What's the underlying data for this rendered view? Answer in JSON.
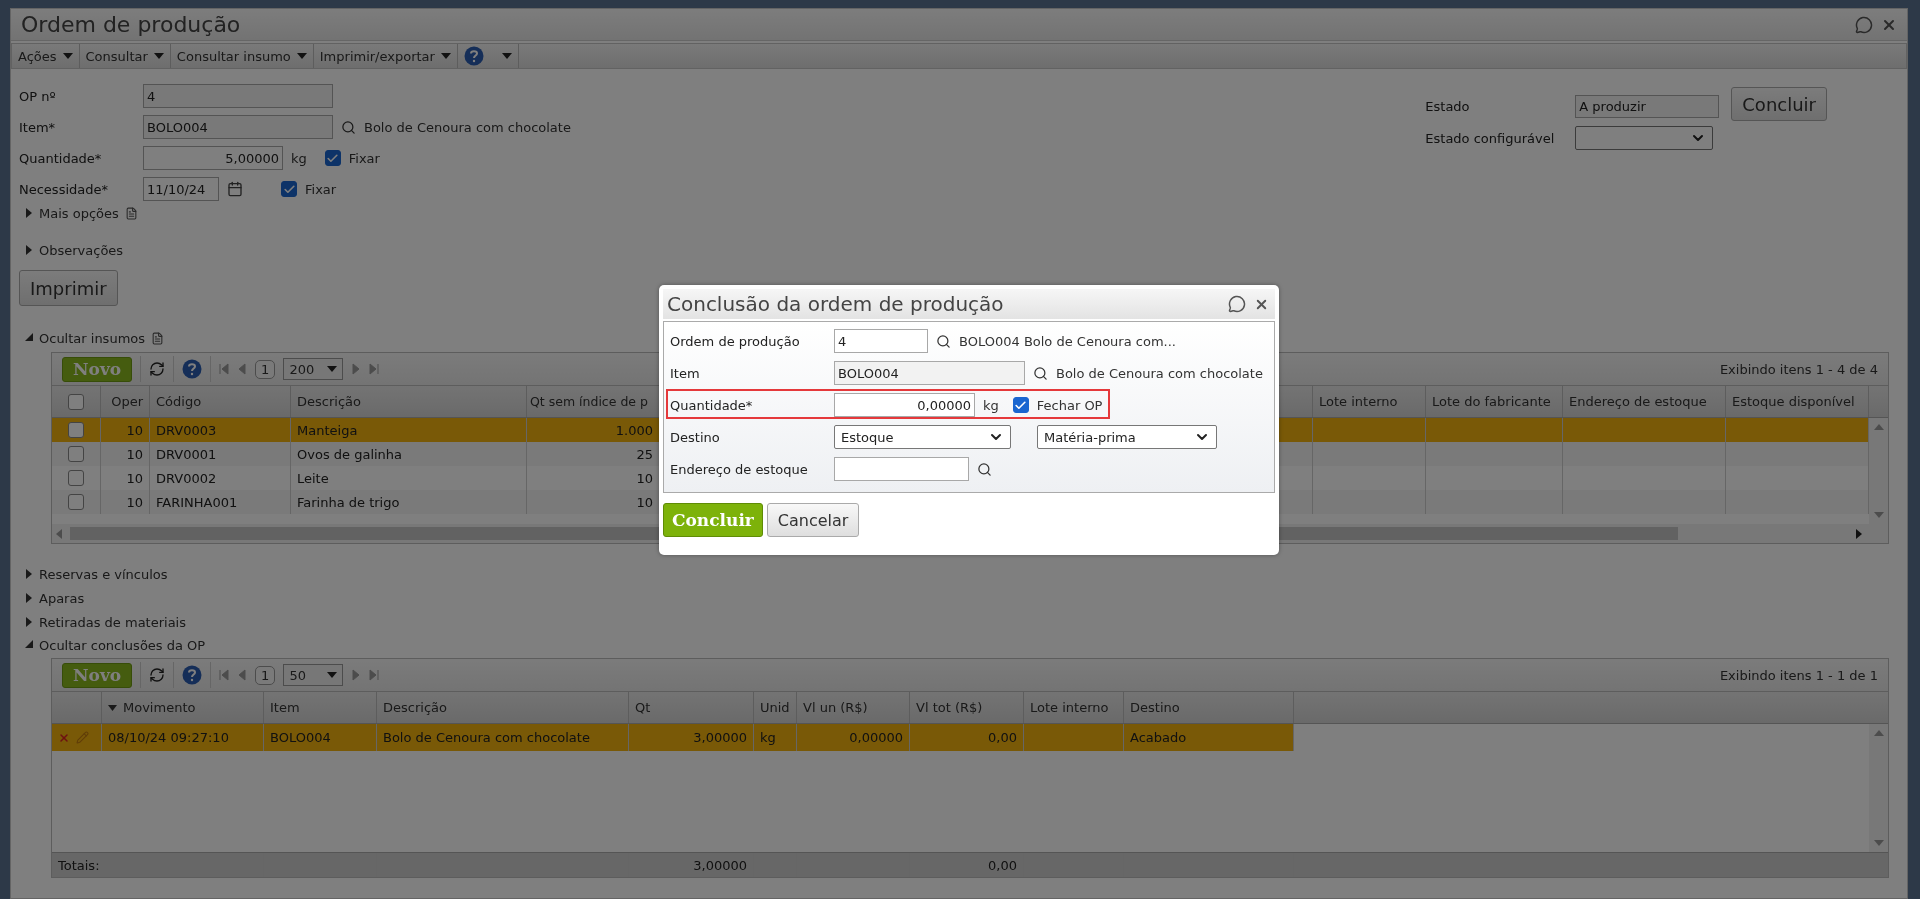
{
  "window": {
    "title": "Ordem de produção"
  },
  "menu": [
    {
      "label": "Ações"
    },
    {
      "label": "Consultar"
    },
    {
      "label": "Consultar insumo"
    },
    {
      "label": "Imprimir/exportar"
    }
  ],
  "form": {
    "fields": [
      {
        "kind": "text",
        "label": "OP nº",
        "value": "4"
      },
      {
        "kind": "lookup",
        "label": "Item*",
        "value": "BOLO004",
        "description": "Bolo de Cenoura com chocolate"
      },
      {
        "kind": "quantity",
        "label": "Quantidade*",
        "value": "5,00000",
        "unit": "kg",
        "fix": {
          "label": "Fixar",
          "checked": true
        }
      },
      {
        "kind": "date",
        "label": "Necessidade*",
        "value": "11/10/24",
        "fix": {
          "label": "Fixar",
          "checked": true
        }
      }
    ],
    "state": {
      "label": "Estado",
      "value": "A produzir"
    },
    "configurable_state": {
      "label": "Estado configurável"
    },
    "conclude_button": "Concluir"
  },
  "panels": [
    {
      "label": "Mais opções",
      "expanded": false,
      "notes": true
    },
    {
      "label": "Observações",
      "expanded": false,
      "notes": false
    }
  ],
  "print_button": "Imprimir",
  "inputs_section": {
    "label": "Ocultar insumos",
    "expanded": true,
    "grid": {
      "all_checked": false,
      "new_button": "Novo",
      "page": "1",
      "page_size": "200",
      "status": "Exibindo itens 1 - 4 de 4",
      "columns": [
        "Oper",
        "Código",
        "Descrição",
        "Qt sem índice de p",
        "Lote interno",
        "Lote do fabricante",
        "Endereço de estoque",
        "Estoque disponível"
      ],
      "rows": [
        {
          "selected": true,
          "checked": false,
          "cells": [
            "10",
            "DRV0003",
            "Manteiga",
            "1.000"
          ]
        },
        {
          "selected": false,
          "checked": false,
          "cells": [
            "10",
            "DRV0001",
            "Ovos de galinha",
            "25"
          ]
        },
        {
          "selected": false,
          "checked": false,
          "cells": [
            "10",
            "DRV0002",
            "Leite",
            "10"
          ]
        },
        {
          "selected": false,
          "checked": false,
          "cells": [
            "10",
            "FARINHA001",
            "Farinha de trigo",
            "10"
          ]
        }
      ]
    }
  },
  "lower_panels": [
    {
      "label": "Reservas e vínculos",
      "expanded": false
    },
    {
      "label": "Aparas",
      "expanded": false
    },
    {
      "label": "Retiradas de materiais",
      "expanded": false
    }
  ],
  "completions_section": {
    "label": "Ocultar conclusões da OP",
    "expanded": true,
    "grid": {
      "new_button": "Novo",
      "page": "1",
      "page_size": "50",
      "status": "Exibindo itens 1 - 1 de 1",
      "columns": [
        {
          "label": "Movimento",
          "sorted": true
        },
        {
          "label": "Item",
          "sorted": false
        },
        {
          "label": "Descrição",
          "sorted": false
        },
        {
          "label": "Qt",
          "sorted": false
        },
        {
          "label": "Unid",
          "sorted": false
        },
        {
          "label": "Vl un (R$)",
          "sorted": false
        },
        {
          "label": "Vl tot (R$)",
          "sorted": false
        },
        {
          "label": "Lote interno",
          "sorted": false
        },
        {
          "label": "Destino",
          "sorted": false
        }
      ],
      "rows": [
        {
          "selected": true,
          "cells": [
            "08/10/24 09:27:10",
            "BOLO004",
            "Bolo de Cenoura com chocolate",
            "3,00000",
            "kg",
            "0,00000",
            "0,00",
            "",
            "Acabado"
          ]
        }
      ],
      "totals": {
        "label": "Totais:",
        "qt": "3,00000",
        "total_value": "0,00"
      }
    }
  },
  "dialog": {
    "title": "Conclusão da ordem de produção",
    "order": {
      "label": "Ordem de produção",
      "value": "4",
      "description": "BOLO004 Bolo de Cenoura com..."
    },
    "item": {
      "label": "Item",
      "value": "BOLO004",
      "description": "Bolo de Cenoura com chocolate"
    },
    "quantity": {
      "label": "Quantidade*",
      "value": "0,00000",
      "unit": "kg",
      "highlighted": true,
      "close": {
        "label": "Fechar OP",
        "checked": true
      }
    },
    "destination": {
      "label": "Destino",
      "values": [
        "Estoque",
        "Matéria-prima"
      ]
    },
    "address": {
      "label": "Endereço de estoque"
    },
    "buttons": [
      {
        "label": "Concluir",
        "kind": "primary"
      },
      {
        "label": "Cancelar",
        "kind": "secondary"
      }
    ]
  }
}
